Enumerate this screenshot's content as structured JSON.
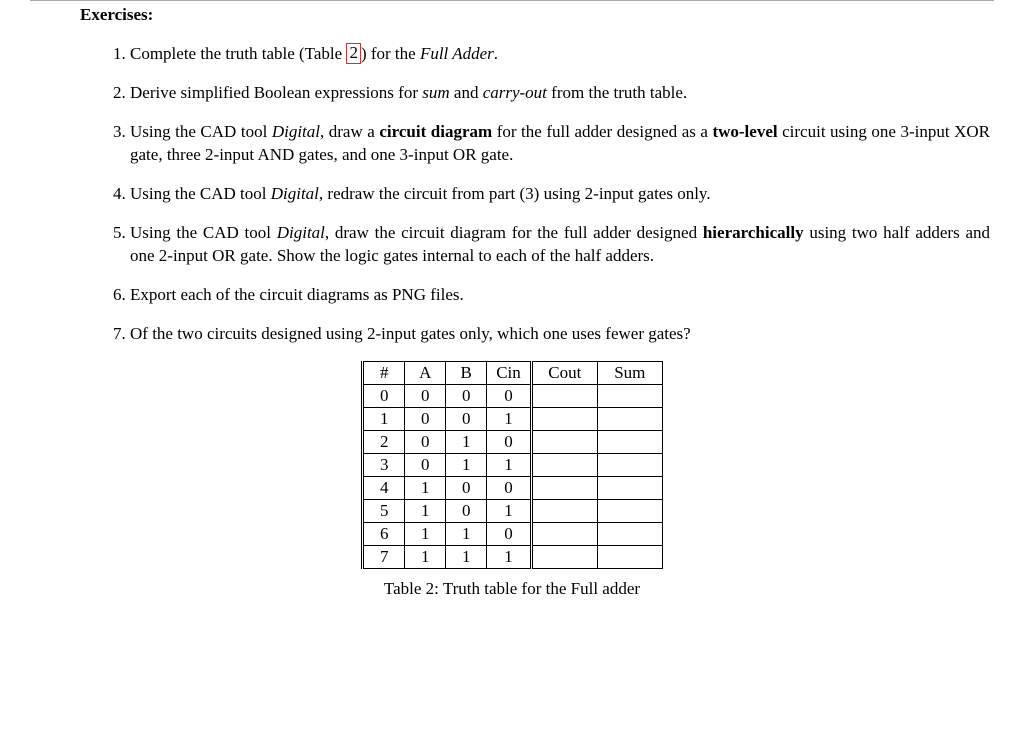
{
  "section_title": "Exercises:",
  "items": [
    {
      "pre": "Complete the truth table (Table ",
      "ref": "2",
      "post1": ") for the ",
      "ital1": "Full Adder",
      "post2": "."
    },
    {
      "pre": "Derive simplified Boolean expressions for ",
      "ital1": "sum",
      "mid1": " and ",
      "ital2": "carry-out",
      "post": " from the truth table."
    },
    {
      "pre": "Using the CAD tool ",
      "ital1": "Digital",
      "mid1": ", draw a ",
      "bold1": "circuit diagram",
      "mid2": " for the full adder designed as a ",
      "bold2": "two-level",
      "post": " circuit using one 3-input XOR gate, three 2-input AND gates, and one 3-input OR gate."
    },
    {
      "pre": "Using the CAD tool ",
      "ital1": "Digital",
      "post": ", redraw the circuit from part (3) using 2-input gates only."
    },
    {
      "pre": "Using the CAD tool ",
      "ital1": "Digital",
      "mid1": ", draw the circuit diagram for the full adder designed ",
      "bold1": "hierarchically",
      "post": " using two half adders and one 2-input OR gate.  Show the logic gates internal to each of the half adders."
    },
    {
      "pre": "Export each of the circuit diagrams as PNG files."
    },
    {
      "pre": "Of the two circuits designed using 2-input gates only, which one uses fewer gates?"
    }
  ],
  "table": {
    "headers": [
      "#",
      "A",
      "B",
      "Cin",
      "Cout",
      "Sum"
    ],
    "rows": [
      [
        "0",
        "0",
        "0",
        "0",
        "",
        ""
      ],
      [
        "1",
        "0",
        "0",
        "1",
        "",
        ""
      ],
      [
        "2",
        "0",
        "1",
        "0",
        "",
        ""
      ],
      [
        "3",
        "0",
        "1",
        "1",
        "",
        ""
      ],
      [
        "4",
        "1",
        "0",
        "0",
        "",
        ""
      ],
      [
        "5",
        "1",
        "0",
        "1",
        "",
        ""
      ],
      [
        "6",
        "1",
        "1",
        "0",
        "",
        ""
      ],
      [
        "7",
        "1",
        "1",
        "1",
        "",
        ""
      ]
    ],
    "caption": "Table 2: Truth table for the Full adder"
  }
}
